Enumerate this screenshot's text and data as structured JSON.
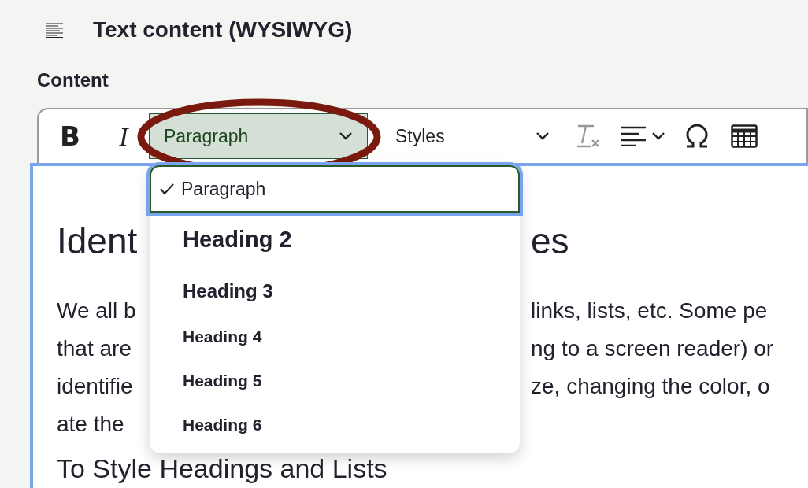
{
  "section": {
    "title": "Text content (WYSIWYG)"
  },
  "field": {
    "label": "Content"
  },
  "toolbar": {
    "items": [
      {
        "kind": "bold",
        "label": "B"
      },
      {
        "kind": "italic",
        "label": "I"
      },
      {
        "kind": "select",
        "label": "Paragraph",
        "open": true,
        "highlighted": true
      },
      {
        "kind": "select",
        "label": "Styles",
        "open": false,
        "highlighted": false
      },
      {
        "kind": "clear"
      },
      {
        "kind": "align"
      },
      {
        "kind": "special"
      },
      {
        "kind": "table"
      }
    ]
  },
  "dropdown": {
    "items": [
      {
        "kind": "paragraph",
        "label": "Paragraph",
        "selected": true
      },
      {
        "kind": "heading2",
        "label": "Heading 2",
        "selected": false
      },
      {
        "kind": "heading3",
        "label": "Heading 3",
        "selected": false
      },
      {
        "kind": "heading4",
        "label": "Heading 4",
        "selected": false
      },
      {
        "kind": "heading5",
        "label": "Heading 5",
        "selected": false
      },
      {
        "kind": "heading6",
        "label": "Heading 6",
        "selected": false
      }
    ]
  },
  "editor": {
    "lines": [
      {
        "kind": "heading",
        "left": "Ident",
        "right": "es"
      },
      {
        "kind": "text",
        "left": "We all b",
        "right": "links, lists, etc. Some pe"
      },
      {
        "kind": "text",
        "left": "that are",
        "right": "ng to a screen reader) or"
      },
      {
        "kind": "text",
        "left": "identifie",
        "right": "ze, changing the color, o"
      },
      {
        "kind": "text",
        "left": "ate the"
      },
      {
        "kind": "subheading",
        "left": "To Style Headings and Lists"
      }
    ]
  }
}
